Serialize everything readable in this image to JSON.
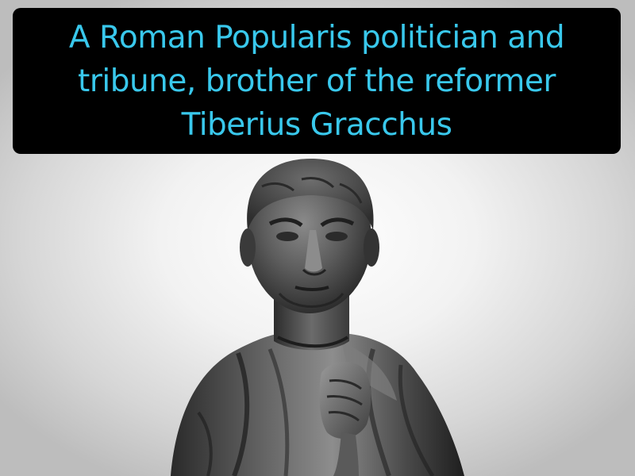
{
  "caption": {
    "text": "A Roman Popularis politician and tribune, brother of the reformer Tiberius Gracchus",
    "text_color": "#39c8ec",
    "box_color": "#000000"
  },
  "illustration": {
    "subject": "bronze-bust-statue-of-roman-man-in-toga"
  }
}
